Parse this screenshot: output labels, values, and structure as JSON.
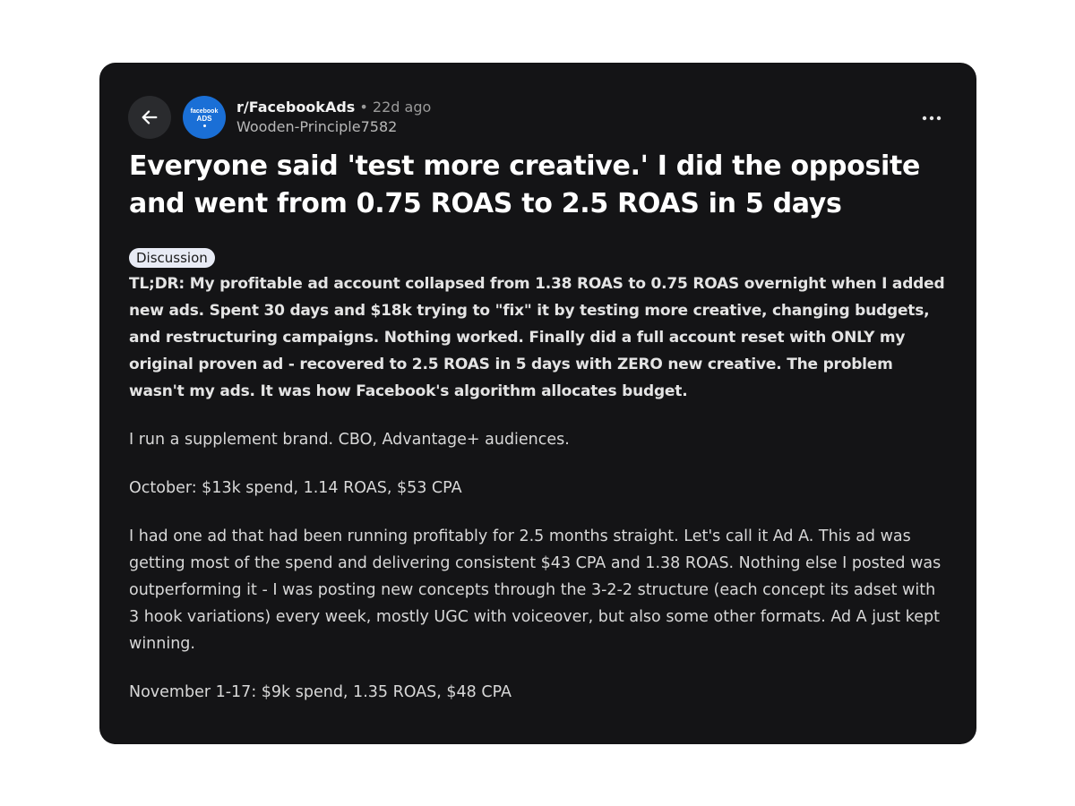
{
  "post": {
    "subreddit": "r/FacebookAds",
    "separator": "•",
    "age": "22d ago",
    "author": "Wooden-Principle7582",
    "avatar": {
      "line1": "facebook",
      "line2": "ADS",
      "color": "#1a6fd6"
    },
    "title": "Everyone said 'test more creative.' I did the opposite and went from 0.75 ROAS to 2.5 ROAS in 5 days",
    "flair": "Discussion",
    "paragraphs": [
      "TL;DR: My profitable ad account collapsed from 1.38 ROAS to 0.75 ROAS overnight when I added new ads. Spent 30 days and $18k trying to \"fix\" it by testing more creative, changing budgets, and restructuring campaigns. Nothing worked. Finally did a full account reset with ONLY my original proven ad - recovered to 2.5 ROAS in 5 days with ZERO new creative. The problem wasn't my ads. It was how Facebook's algorithm allocates budget.",
      "I run a supplement brand. CBO, Advantage+ audiences.",
      "October: $13k spend, 1.14 ROAS, $53 CPA",
      "I had one ad that had been running profitably for 2.5 months straight. Let's call it Ad A. This ad was getting most of the spend and delivering consistent $43 CPA and 1.38 ROAS. Nothing else I posted was outperforming it - I was posting new concepts through the 3-2-2 structure (each concept its adset with 3 hook variations) every week, mostly UGC with voiceover, but also some other formats. Ad A just kept winning.",
      "November 1-17: $9k spend, 1.35 ROAS, $48 CPA"
    ]
  },
  "icons": {
    "back": "arrow-left-icon",
    "more": "more-horizontal-icon"
  },
  "colors": {
    "card_background": "#141416",
    "flair_background": "#e8ebf5",
    "back_button_background": "#2a2b2e"
  }
}
